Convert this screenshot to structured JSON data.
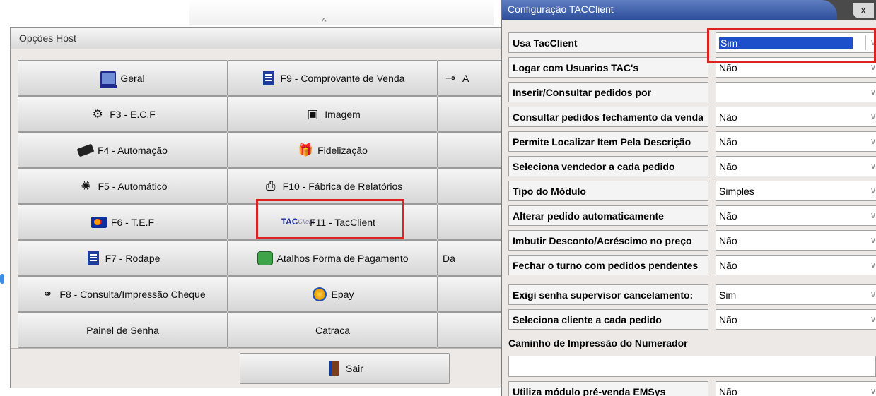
{
  "host": {
    "title": "Opções Host",
    "buttons": [
      [
        "Geral",
        "F9 - Comprovante de Venda",
        "A"
      ],
      [
        "F3 - E.C.F",
        "Imagem",
        ""
      ],
      [
        "F4 - Automação",
        "Fidelização",
        ""
      ],
      [
        "F5 - Automático",
        "F10 - Fábrica de Relatórios",
        ""
      ],
      [
        "F6 - T.E.F",
        "F11 - TacClient",
        ""
      ],
      [
        "F7 - Rodape",
        "Atalhos Forma de Pagamento",
        "Da"
      ],
      [
        "F8 - Consulta/Impressão Cheque",
        "Epay",
        ""
      ],
      [
        "Painel de Senha",
        "Catraca",
        ""
      ]
    ],
    "sair": "Sair",
    "tac_icon_text": "TAC",
    "tac_icon_sub": "Client"
  },
  "config": {
    "title": "Configuração TACClient",
    "close": "x",
    "rows": [
      {
        "label": "Usa TacClient",
        "value": "Sim"
      },
      {
        "label": "Logar com Usuarios TAC's",
        "value": "Não"
      },
      {
        "label": "Inserir/Consultar pedidos por",
        "value": ""
      },
      {
        "label": "Consultar pedidos fechamento da venda",
        "value": "Não"
      },
      {
        "label": "Permite Localizar Item Pela Descrição",
        "value": "Não"
      },
      {
        "label": "Seleciona vendedor a cada pedido",
        "value": "Não"
      },
      {
        "label": "Tipo do Módulo",
        "value": "Simples"
      },
      {
        "label": "Alterar pedido automaticamente",
        "value": "Não"
      },
      {
        "label": "Imbutir Desconto/Acréscimo no preço",
        "value": "Não"
      },
      {
        "label": "Fechar o turno com pedidos pendentes",
        "value": "Não"
      },
      {
        "label": "Exigi senha supervisor cancelamento:",
        "value": "Sim"
      },
      {
        "label": "Seleciona cliente a cada pedido",
        "value": "Não"
      }
    ],
    "caminho_label": "Caminho de Impressão do Numerador",
    "caminho_value": "",
    "last_row": {
      "label": "Utiliza módulo pré-venda EMSys",
      "value": "Não"
    }
  },
  "colors": {
    "highlight": "#e02121",
    "selection": "#1c4fc9",
    "title_blue": "#2f4e9c"
  }
}
